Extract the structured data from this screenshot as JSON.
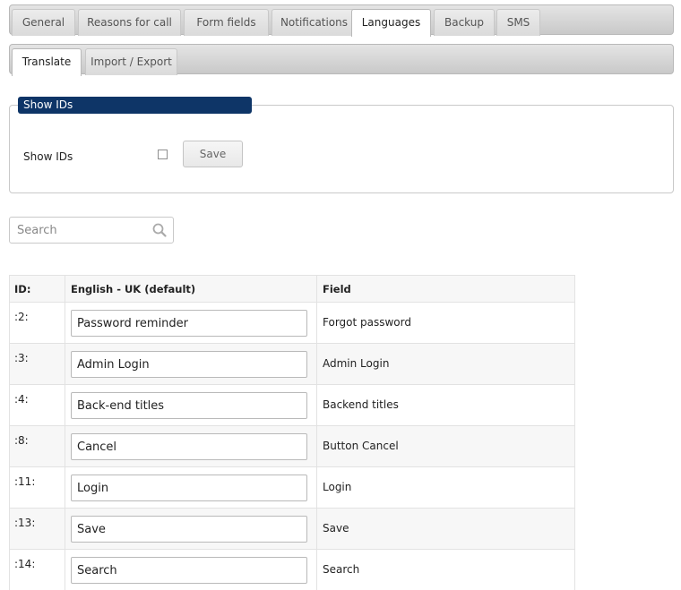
{
  "tabs": [
    {
      "label": "General",
      "active": false
    },
    {
      "label": "Reasons for call",
      "active": false
    },
    {
      "label": "Form fields",
      "active": false
    },
    {
      "label": "Notifications",
      "active": false
    },
    {
      "label": "Languages",
      "active": true
    },
    {
      "label": "Backup",
      "active": false
    },
    {
      "label": "SMS",
      "active": false
    }
  ],
  "subtabs": [
    {
      "label": "Translate",
      "active": true
    },
    {
      "label": "Import / Export",
      "active": false
    }
  ],
  "showids": {
    "legend": "Show IDs",
    "label": "Show IDs",
    "checked": false,
    "save_label": "Save"
  },
  "search": {
    "placeholder": "Search",
    "icon": "search-icon"
  },
  "table": {
    "headers": {
      "id": "ID:",
      "english": "English - UK (default)",
      "field": "Field"
    },
    "rows": [
      {
        "id": ":2:",
        "value": "Password reminder",
        "field": "Forgot password"
      },
      {
        "id": ":3:",
        "value": "Admin Login",
        "field": "Admin Login"
      },
      {
        "id": ":4:",
        "value": "Back-end titles",
        "field": "Backend titles"
      },
      {
        "id": ":8:",
        "value": "Cancel",
        "field": "Button Cancel"
      },
      {
        "id": ":11:",
        "value": "Login",
        "field": "Login"
      },
      {
        "id": ":13:",
        "value": "Save",
        "field": "Save"
      },
      {
        "id": ":14:",
        "value": "Search",
        "field": "Search"
      }
    ]
  },
  "colors": {
    "legend_bg": "#0e3567",
    "row_alt": "#f7f7f7"
  }
}
